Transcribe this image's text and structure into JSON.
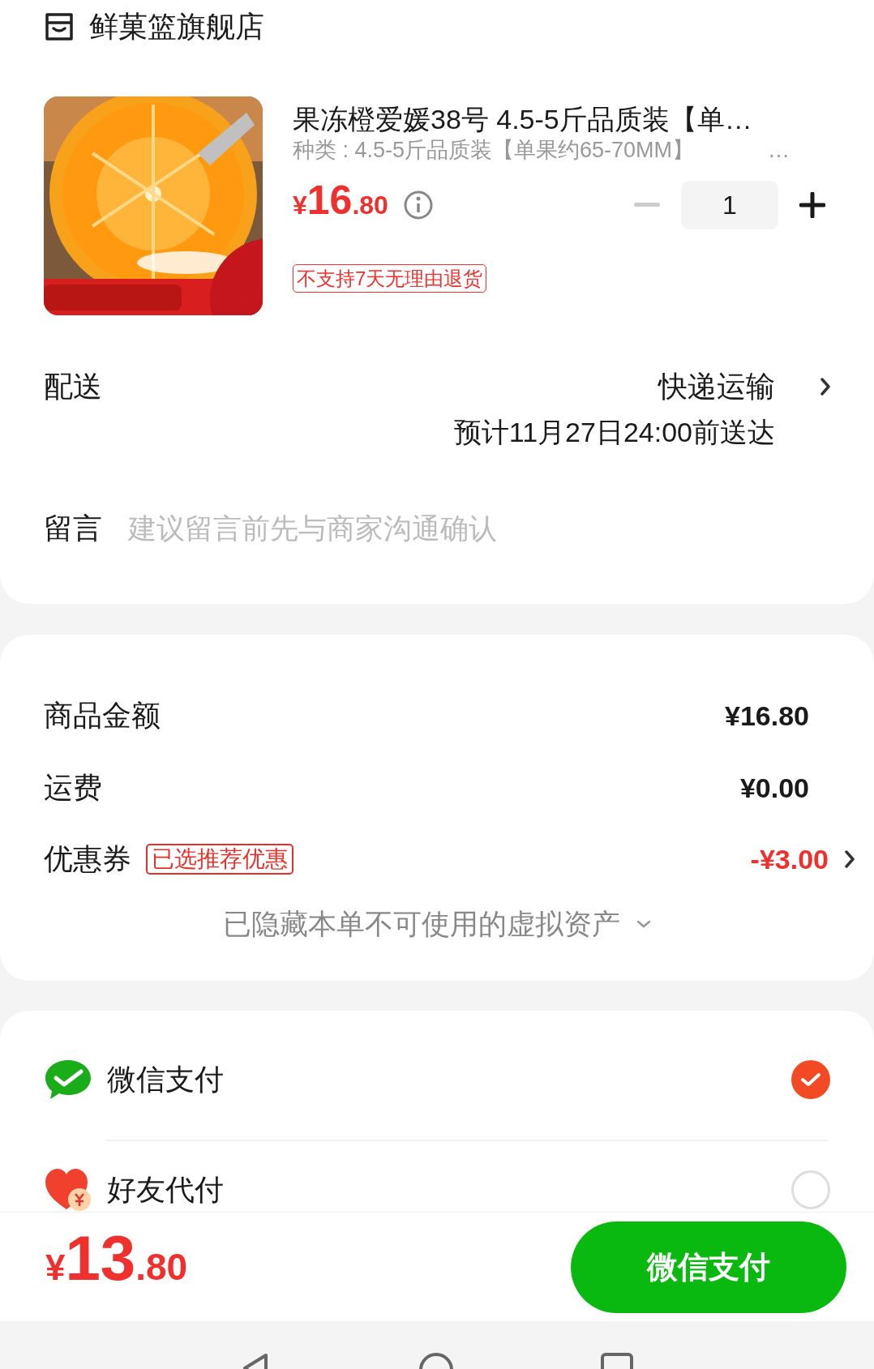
{
  "store": {
    "name": "鲜菓篮旗舰店"
  },
  "product": {
    "title": "果冻橙爱媛38号 4.5-5斤品质装【单…",
    "variant": "种类 : 4.5-5斤品质装【单果约65-70MM】",
    "variant_more": "…",
    "price": {
      "currency": "¥",
      "integer": "16",
      "decimal": ".80"
    },
    "stepper": {
      "quantity": "1",
      "minus_disabled": true
    },
    "tag": "不支持7天无理由退货"
  },
  "delivery": {
    "label": "配送",
    "method": "快递运输",
    "estimate": "预计11月27日24:00前送达"
  },
  "message": {
    "label": "留言",
    "placeholder": "建议留言前先与商家沟通确认"
  },
  "summary": {
    "rows": [
      {
        "kind": "plain",
        "label": "商品金额",
        "value": "¥16.80"
      },
      {
        "kind": "plain",
        "label": "运费",
        "value": "¥0.00"
      },
      {
        "kind": "coupon",
        "label": "优惠券",
        "badge": "已选推荐优惠",
        "value": "-¥3.00"
      }
    ],
    "hidden_note": "已隐藏本单不可使用的虚拟资产"
  },
  "payment_methods": [
    {
      "kind": "wechat",
      "label": "微信支付",
      "selected": true
    },
    {
      "kind": "friend",
      "label": "好友代付",
      "selected": false
    }
  ],
  "footer": {
    "total": {
      "currency": "¥",
      "integer": "13",
      "decimal": ".80"
    },
    "pay_button": "微信支付"
  }
}
